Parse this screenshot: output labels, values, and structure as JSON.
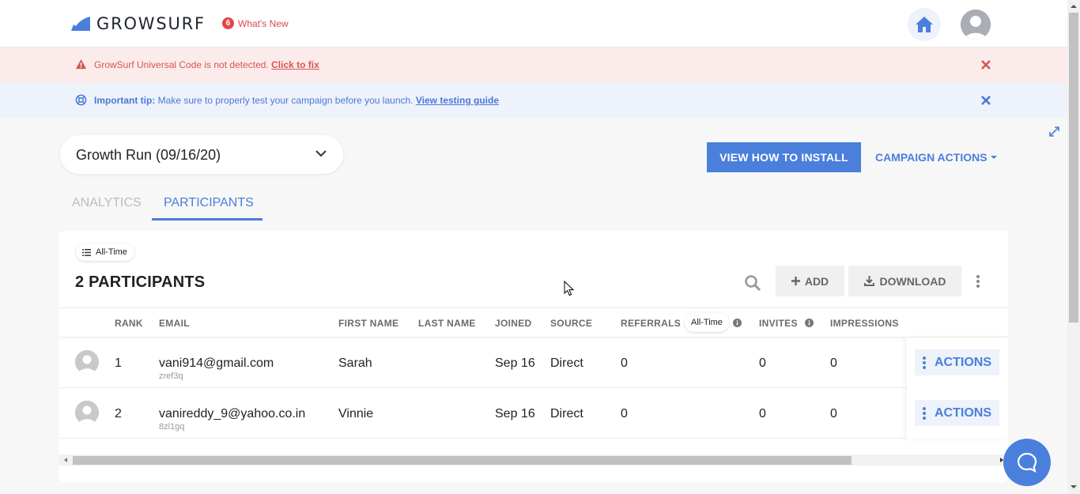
{
  "brand": {
    "name": "GROWSURF",
    "accent": "#4a7fdc",
    "danger": "#e0464a"
  },
  "header": {
    "whats_new_count": "6",
    "whats_new_label": "What's New",
    "home_icon": "home-icon",
    "avatar_icon": "user-avatar-icon"
  },
  "banners": {
    "error": {
      "text": "GrowSurf Universal Code is not detected.",
      "link": "Click to fix",
      "icon": "warning-icon"
    },
    "tip": {
      "label": "Important tip:",
      "text": " Make sure to properly test your campaign before you launch.",
      "link": "View testing guide",
      "icon": "lifebuoy-icon"
    }
  },
  "campaign": {
    "selected": "Growth Run (09/16/20)",
    "install_label": "VIEW HOW TO INSTALL",
    "actions_label": "CAMPAIGN ACTIONS"
  },
  "tabs": [
    {
      "label": "ANALYTICS",
      "active": false
    },
    {
      "label": "PARTICIPANTS",
      "active": true
    }
  ],
  "participants": {
    "filter_label": "All-Time",
    "count_title": "2 PARTICIPANTS",
    "add_label": "ADD",
    "download_label": "DOWNLOAD",
    "columns": {
      "rank": "RANK",
      "email": "EMAIL",
      "first_name": "FIRST NAME",
      "last_name": "LAST NAME",
      "joined": "JOINED",
      "source": "SOURCE",
      "referrals": "REFERRALS",
      "referrals_period": "All-Time",
      "invites": "INVITES",
      "impressions": "IMPRESSIONS"
    },
    "rows": [
      {
        "rank": "1",
        "email": "vani914@gmail.com",
        "code": "zref3q",
        "first_name": "Sarah",
        "last_name": "",
        "joined": "Sep 16",
        "source": "Direct",
        "referrals": "0",
        "invites": "0",
        "impressions": "0",
        "actions": "ACTIONS"
      },
      {
        "rank": "2",
        "email": "vanireddy_9@yahoo.co.in",
        "code": "8zl1gq",
        "first_name": "Vinnie",
        "last_name": "",
        "joined": "Sep 16",
        "source": "Direct",
        "referrals": "0",
        "invites": "0",
        "impressions": "0",
        "actions": "ACTIONS"
      }
    ]
  }
}
